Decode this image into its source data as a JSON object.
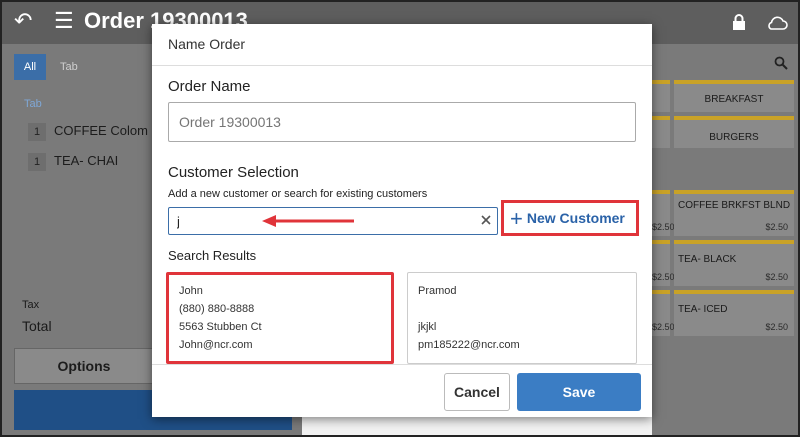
{
  "app": {
    "title": "Order 19300013",
    "back_icon": "back-arrow-icon",
    "menu_icon": "hamburger-menu-icon",
    "lock_icon": "lock-icon",
    "cloud_icon": "cloud-icon"
  },
  "order_panel": {
    "tabs": [
      "All",
      "Tab"
    ],
    "section_label": "Tab",
    "items": [
      {
        "qty": "1",
        "name": "COFFEE Colom"
      },
      {
        "qty": "1",
        "name": "TEA- CHAI"
      }
    ],
    "tax_label": "Tax",
    "total_label": "Total",
    "options_label": "Options"
  },
  "menu_panel": {
    "tiles": [
      {
        "name": "BREAKFAST",
        "price": ""
      },
      {
        "name": "BURGERS",
        "price": ""
      },
      {
        "name": "COFFEE BRKFST BLND",
        "price": "$2.50"
      },
      {
        "name": "TEA- BLACK",
        "price": "$2.50"
      },
      {
        "name": "TEA- ICED",
        "price": "$2.50"
      }
    ],
    "partial_prices": [
      "$2.50",
      "$2.50",
      "$2.50"
    ]
  },
  "dialog": {
    "title": "Name Order",
    "order_name_label": "Order Name",
    "order_name_placeholder": "Order 19300013",
    "customer_selection_label": "Customer Selection",
    "customer_hint": "Add a new customer or search for existing customers",
    "search_value": "j",
    "new_customer_label": "New Customer",
    "search_results_label": "Search Results",
    "results": [
      {
        "lines": [
          "John",
          "(880) 880-8888",
          "5563 Stubben Ct",
          "John@ncr.com"
        ]
      },
      {
        "lines": [
          "Pramod",
          "",
          "jkjkl",
          "pm185222@ncr.com"
        ]
      }
    ],
    "cancel_label": "Cancel",
    "save_label": "Save"
  },
  "colors": {
    "accent": "#3b7dc4",
    "highlight": "#e0343a",
    "overlay": "#7a7a7a"
  }
}
